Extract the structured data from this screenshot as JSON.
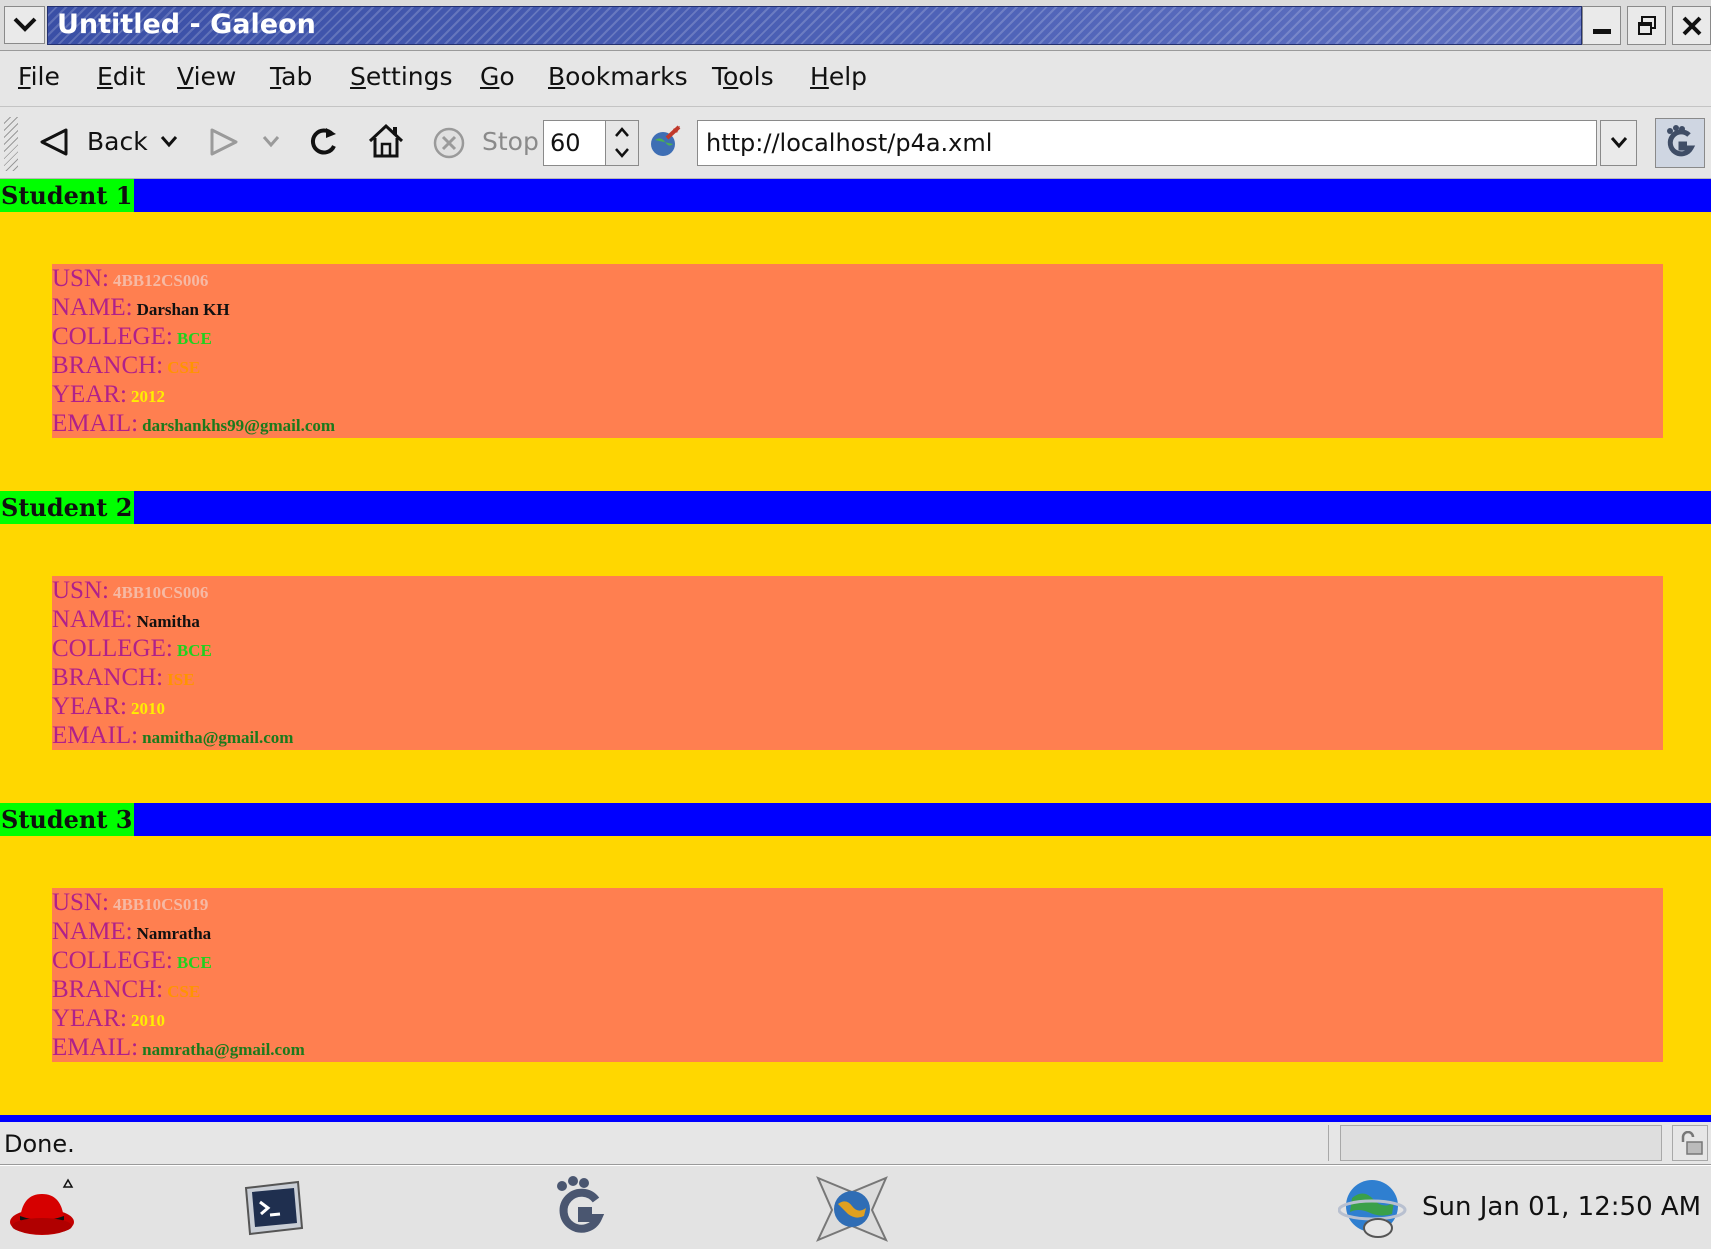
{
  "window": {
    "title": "Untitled - Galeon"
  },
  "menubar": {
    "items": [
      {
        "label": "File",
        "key": "F",
        "rest": "ile"
      },
      {
        "label": "Edit",
        "key": "E",
        "rest": "dit"
      },
      {
        "label": "View",
        "key": "V",
        "rest": "iew"
      },
      {
        "label": "Tab",
        "key": "T",
        "rest": "ab"
      },
      {
        "label": "Settings",
        "key": "S",
        "rest": "ettings"
      },
      {
        "label": "Go",
        "key": "G",
        "rest": "o"
      },
      {
        "label": "Bookmarks",
        "key": "B",
        "rest": "ookmarks"
      },
      {
        "label": "Tools",
        "pre": "T",
        "key": "o",
        "rest": "ols"
      },
      {
        "label": "Help",
        "key": "H",
        "rest": "elp"
      }
    ]
  },
  "toolbar": {
    "back_label": "Back",
    "stop_label": "Stop",
    "zoom_value": "60",
    "url_value": "http://localhost/p4a.xml"
  },
  "field_labels": {
    "usn": "USN:",
    "name": "NAME:",
    "college": "COLLEGE:",
    "branch": "BRANCH:",
    "year": "YEAR:",
    "email": "EMAIL:"
  },
  "field_colors": {
    "label": "#b0208a",
    "usn": "#f6b9a4",
    "name": "#111111",
    "college": "#1fd21f",
    "branch": "#ff9400",
    "year": "#ffee00",
    "email": "#1c7a1c"
  },
  "students": [
    {
      "header": "Student 1",
      "usn": "4BB12CS006",
      "name": "Darshan KH",
      "college": "BCE",
      "branch": "CSE",
      "year": "2012",
      "email": "darshankhs99@gmail.com"
    },
    {
      "header": "Student 2",
      "usn": "4BB10CS006",
      "name": "Namitha",
      "college": "BCE",
      "branch": "ISE",
      "year": "2010",
      "email": "namitha@gmail.com"
    },
    {
      "header": "Student 3",
      "usn": "4BB10CS019",
      "name": "Namratha",
      "college": "BCE",
      "branch": "CSE",
      "year": "2010",
      "email": "namratha@gmail.com"
    }
  ],
  "statusbar": {
    "text": "Done."
  },
  "taskbar": {
    "clock": "Sun Jan 01, 12:50 AM",
    "icons": [
      "redhat-menu-icon",
      "terminal-icon",
      "galeon-launcher-icon",
      "web-browser-icon",
      "network-globe-icon"
    ]
  },
  "colors": {
    "page_background": "#ffd700",
    "student_header_bar": "#0000ff",
    "student_label_bg": "#00ff00",
    "student_box": "#ff7f50",
    "titlebar": "#4f63b8"
  }
}
